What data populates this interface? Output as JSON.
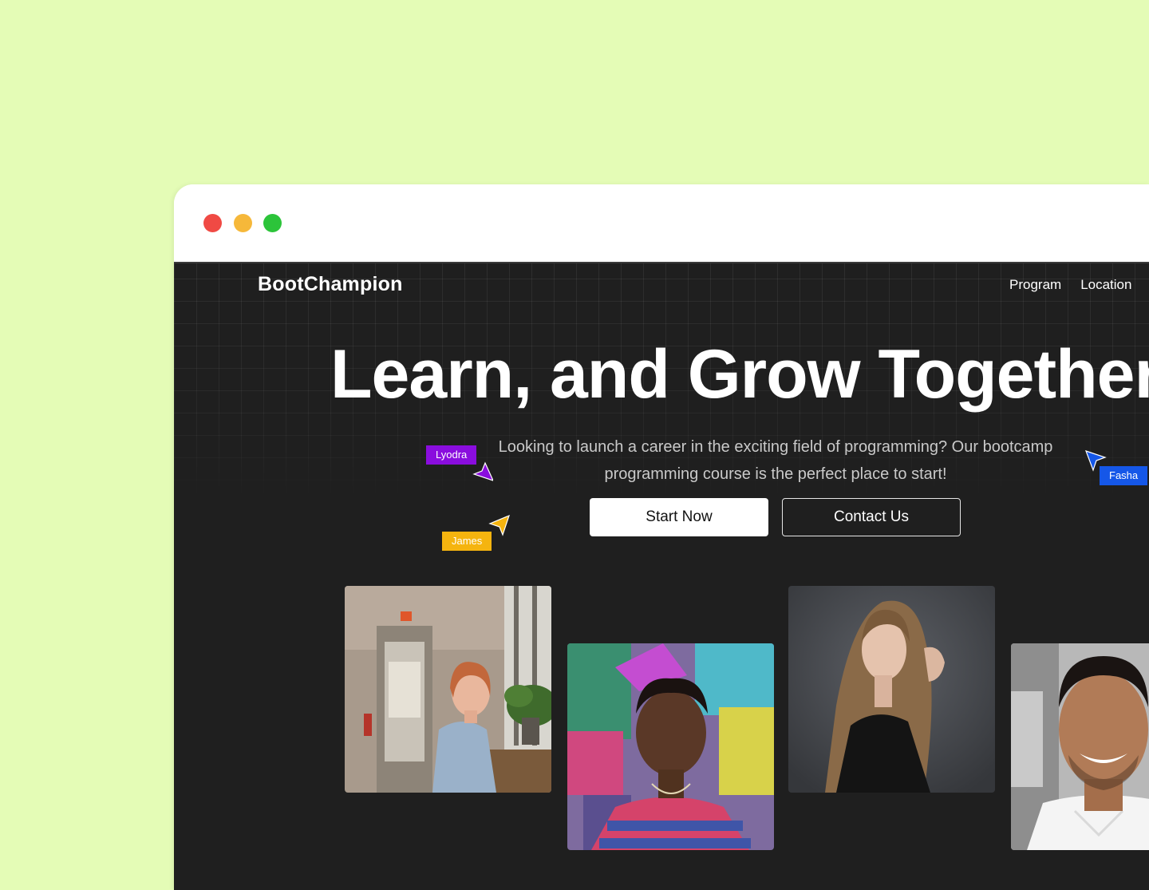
{
  "brand": "BootChampion",
  "nav": {
    "items": [
      "Program",
      "Location"
    ]
  },
  "hero": {
    "title": "Learn, and Grow Together",
    "subtitle": "Looking to launch a career in the exciting field of programming? Our bootcamp programming course is the perfect place to start!",
    "primary_button": "Start Now",
    "secondary_button": "Contact Us"
  },
  "cursors": [
    {
      "name": "Lyodra",
      "color": "#8a0dde"
    },
    {
      "name": "James",
      "color": "#f5b40f"
    },
    {
      "name": "Fasha",
      "color": "#1557e8"
    }
  ],
  "colors": {
    "page_background": "#e4fcb6",
    "site_background": "#1f1f1f",
    "window_red": "#f04a44",
    "window_yellow": "#f6b83a",
    "window_green": "#2cc43a"
  }
}
